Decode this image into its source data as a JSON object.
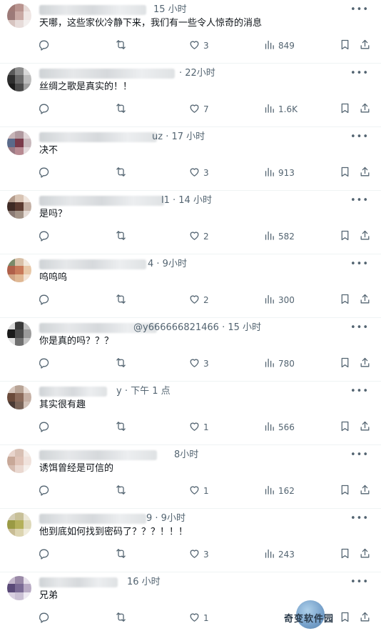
{
  "replies": [
    {
      "meta": "15 小时",
      "text": "天哪，这些家伙冷静下来，我们有一些令人惊奇的消息",
      "likes": "3",
      "views": "849",
      "avatar_colors": [
        "#a07a76",
        "#b9948f",
        "#e6d9d6",
        "#9c7a78",
        "#c9a9a4",
        "#efe6e4",
        "#d7c4c0",
        "#e7dcda",
        "#f3efee"
      ]
    },
    {
      "meta": "· 22小时",
      "text": "丝绸之歌是真实的！！",
      "likes": "7",
      "views": "1.6K",
      "avatar_colors": [
        "#5a5a5a",
        "#8c8c8c",
        "#d9d9d9",
        "#2e2e2e",
        "#6a6a6a",
        "#bdbdbd",
        "#1c1c1c",
        "#4a4a4a",
        "#9e9e9e"
      ]
    },
    {
      "meta": "uz · 17 小时",
      "text": "决不",
      "likes": "3",
      "views": "913",
      "avatar_colors": [
        "#c7b4b7",
        "#b19aa0",
        "#e2d7d9",
        "#5a6a8a",
        "#7a3a4a",
        "#c8b8bc",
        "#9a7a84",
        "#b88a92",
        "#e4dadc"
      ]
    },
    {
      "meta": "l1 · 14 小时",
      "text": "是吗？",
      "likes": "2",
      "views": "582",
      "avatar_colors": [
        "#b49c8c",
        "#d8c4b4",
        "#f0e6de",
        "#3e2a24",
        "#5a3a30",
        "#c4b0a4",
        "#8a7a74",
        "#a49488",
        "#e6dcd6"
      ]
    },
    {
      "meta": "4 · 9小时",
      "text": "呜呜呜",
      "likes": "2",
      "views": "300",
      "avatar_colors": [
        "#7a8a6a",
        "#d8c0a8",
        "#f2e8dc",
        "#b0604a",
        "#c87a5a",
        "#e8c8a8",
        "#d0a484",
        "#e0b894",
        "#f4e4d4"
      ]
    },
    {
      "meta": "@y666666821466 · 15 小时",
      "text": "你是真的吗？？？",
      "likes": "3",
      "views": "780",
      "avatar_colors": [
        "#d9d9d9",
        "#3a3a3a",
        "#bfbfbf",
        "#1a1a1a",
        "#4a4a4a",
        "#9a9a9a",
        "#e0e0e0",
        "#707070",
        "#c4c4c4"
      ]
    },
    {
      "meta": "y · 下午 1 点",
      "text": "其实很有趣",
      "likes": "1",
      "views": "566",
      "avatar_colors": [
        "#d6c6bc",
        "#b8a496",
        "#e8ddd6",
        "#6a4a3a",
        "#8a6a5a",
        "#c6b0a4",
        "#4a3a34",
        "#7a6458",
        "#d2c2b8"
      ]
    },
    {
      "meta": "8小时",
      "text": "诱饵曾经是可信的",
      "likes": "1",
      "views": "162",
      "avatar_colors": [
        "#e8d4cc",
        "#d8c0b4",
        "#f4ebe6",
        "#c8a898",
        "#e0c4b8",
        "#f0e2dc",
        "#d6bcb0",
        "#ead8d0",
        "#f6f0ec"
      ]
    },
    {
      "meta": "9 · 9小时",
      "text": "他到底如何找到密码了？？？！！！",
      "likes": "3",
      "views": "243",
      "avatar_colors": [
        "#d4cdb4",
        "#c8c098",
        "#ece8d8",
        "#9a9a44",
        "#b4b05a",
        "#ddd8b8",
        "#c8bc94",
        "#dcd4b0",
        "#f0ecdc"
      ]
    },
    {
      "meta": "16 小时",
      "text": "兄弟",
      "likes": "1",
      "views": "",
      "avatar_colors": [
        "#c4b8cc",
        "#9a8aa8",
        "#e6e0ea",
        "#5a4a78",
        "#7a6a94",
        "#b8aac4",
        "#d8cfe0",
        "#cac0d4",
        "#eeeaf2"
      ]
    }
  ],
  "icons": {
    "reply": "reply-icon",
    "retweet": "retweet-icon",
    "like": "heart-icon",
    "views": "views-icon",
    "bookmark": "bookmark-icon",
    "share": "share-icon",
    "more": "more-icon"
  },
  "watermark": "奇变软件园",
  "colors": {
    "text": "#0f1419",
    "secondary": "#536471",
    "divider": "#eff3f4"
  }
}
